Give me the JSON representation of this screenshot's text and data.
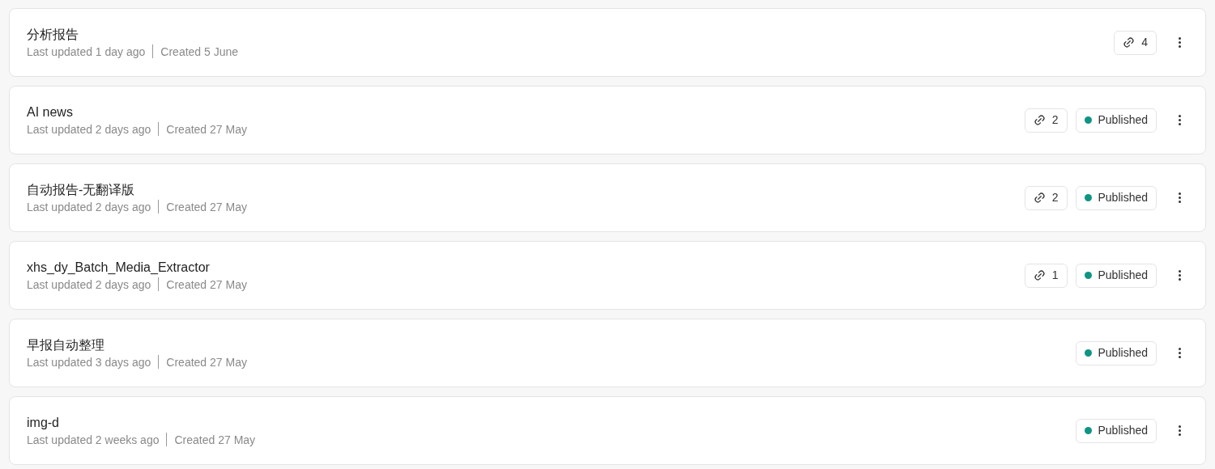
{
  "items": [
    {
      "name": "分析报告",
      "updated": "Last updated 1 day ago",
      "created": "Created 5 June",
      "links": "4"
    },
    {
      "name": "AI news",
      "updated": "Last updated 2 days ago",
      "created": "Created 27 May",
      "links": "2",
      "status": {
        "label": "Published",
        "color": "#0f9484"
      }
    },
    {
      "name": "自动报告-无翻译版",
      "updated": "Last updated 2 days ago",
      "created": "Created 27 May",
      "links": "2",
      "status": {
        "label": "Published",
        "color": "#0f9484"
      }
    },
    {
      "name": "xhs_dy_Batch_Media_Extractor",
      "updated": "Last updated 2 days ago",
      "created": "Created 27 May",
      "links": "1",
      "status": {
        "label": "Published",
        "color": "#0f9484"
      }
    },
    {
      "name": "早报自动整理",
      "updated": "Last updated 3 days ago",
      "created": "Created 27 May",
      "status": {
        "label": "Published",
        "color": "#0f9484"
      }
    },
    {
      "name": "img-d",
      "updated": "Last updated 2 weeks ago",
      "created": "Created 27 May",
      "status": {
        "label": "Published",
        "color": "#0f9484"
      }
    }
  ]
}
